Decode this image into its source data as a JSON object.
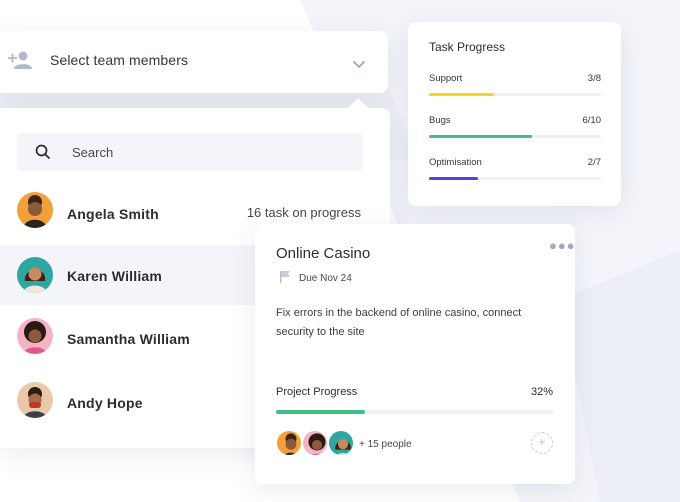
{
  "selector": {
    "label": "Select team members",
    "icon": "add-person-icon"
  },
  "search": {
    "placeholder": "Search"
  },
  "members": [
    {
      "name": "Angela Smith",
      "meta": "16 task on progress",
      "avatar_color": "#f2a03a"
    },
    {
      "name": "Karen William",
      "meta": "",
      "avatar_color": "#2fa6a0"
    },
    {
      "name": "Samantha William",
      "meta": "",
      "avatar_color": "#f3b3c4"
    },
    {
      "name": "Andy Hope",
      "meta": "",
      "avatar_color": "#e9c9a9"
    }
  ],
  "task_progress": {
    "title": "Task Progress",
    "items": [
      {
        "label": "Support",
        "count": "3/8",
        "progress": 0.375,
        "color": "#f5d42e"
      },
      {
        "label": "Bugs",
        "count": "6/10",
        "progress": 0.6,
        "color": "#3fbf83"
      },
      {
        "label": "Optimisation",
        "count": "2/7",
        "progress": 0.2857,
        "color": "#5d3fe0"
      }
    ]
  },
  "project_card": {
    "title": "Online Casino",
    "due": "Due Nov 24",
    "description": "Fix errors in the backend of online casino, connect security to the site",
    "progress_label": "Project Progress",
    "progress_value": "32%",
    "progress": 0.32,
    "progress_color": "#3fbf83",
    "people": "+ 15 people",
    "add_symbol": "+"
  }
}
